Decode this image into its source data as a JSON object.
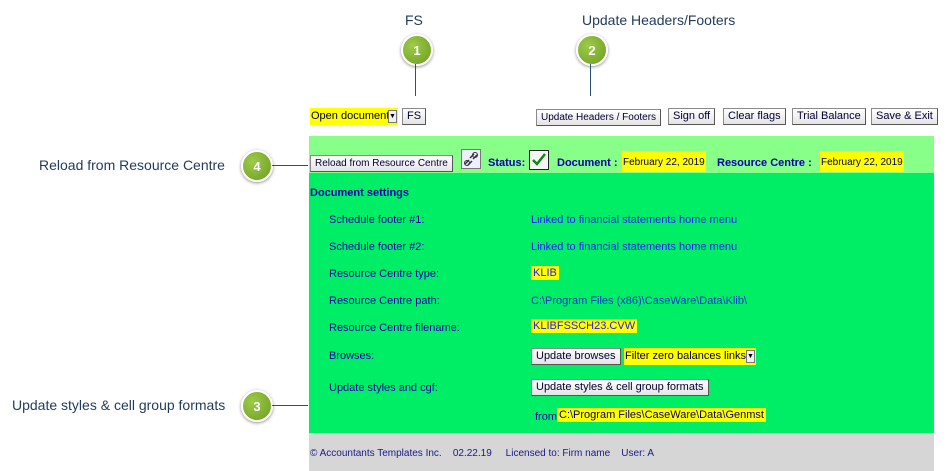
{
  "callouts": {
    "fs": {
      "label": "FS",
      "number": "1"
    },
    "update_headers": {
      "label": "Update Headers/Footers",
      "number": "2"
    },
    "update_styles": {
      "label": "Update styles & cell group formats",
      "number": "3"
    },
    "reload": {
      "label": "Reload from Resource Centre",
      "number": "4"
    }
  },
  "toolbar": {
    "open_document": "Open document",
    "fs_button": "FS",
    "update_headers_footers": "Update Headers / Footers",
    "sign_off": "Sign off",
    "clear_flags": "Clear flags",
    "trial_balance": "Trial Balance",
    "save_exit": "Save & Exit"
  },
  "header": {
    "reload_button": "Reload from Resource Centre",
    "status_label": "Status:",
    "document_label": "Document :",
    "document_date": "February 22, 2019",
    "resource_centre_label": "Resource Centre :",
    "resource_centre_date": "February 22, 2019"
  },
  "settings": {
    "title": "Document settings",
    "rows": [
      {
        "label": "Schedule footer #1:",
        "value": "Linked to financial statements home menu"
      },
      {
        "label": "Schedule footer #2:",
        "value": "Linked to financial statements home menu"
      },
      {
        "label": "Resource Centre type:",
        "value": "KLIB"
      },
      {
        "label": "Resource Centre path:",
        "value": "C:\\Program Files (x86)\\CaseWare\\Data\\Klib\\"
      },
      {
        "label": "Resource Centre filename:",
        "value": "KLIBFSSCH23.CVW"
      },
      {
        "label": "Browses:",
        "value": ""
      },
      {
        "label": "Update styles and cgf:",
        "value": ""
      }
    ],
    "update_browses_button": "Update browses",
    "filter_dropdown": "Filter zero balances links",
    "update_styles_button": "Update styles & cell group formats",
    "from_label": "from:",
    "from_path": "C:\\Program Files\\CaseWare\\Data\\Genmst"
  },
  "footer": {
    "copyright": "© Accountants Templates Inc.",
    "version": "02.22.19",
    "licensed": "Licensed to: Firm name",
    "user": "User: A"
  },
  "colors": {
    "panel_body": "#00ee66",
    "panel_header": "#88ff88",
    "highlight": "#ffff00",
    "badge": "#7fb02b"
  }
}
